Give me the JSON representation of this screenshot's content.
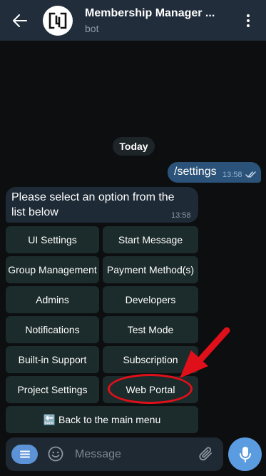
{
  "header": {
    "title": "Membership Manager ...",
    "subtitle": "bot",
    "back_icon": "arrow-left-icon",
    "menu_icon": "more-vertical-icon"
  },
  "date_badge": "Today",
  "outgoing_message": {
    "text": "/settings",
    "time": "13:58",
    "status_icon": "double-check-icon"
  },
  "incoming_message": {
    "text": "Please select an option from the list below",
    "time": "13:58"
  },
  "keyboard": {
    "ui_settings": "UI Settings",
    "start_message": "Start Message",
    "group_management": "Group Management",
    "payment_methods": "Payment Method(s)",
    "admins": "Admins",
    "developers": "Developers",
    "notifications": "Notifications",
    "test_mode": "Test Mode",
    "builtin_support": "Built-in Support",
    "subscription": "Subscription",
    "project_settings": "Project Settings",
    "web_portal": "Web Portal",
    "back_main_menu": "🔙 Back to the main menu"
  },
  "composer": {
    "placeholder": "Message",
    "menu_icon": "bot-menu-icon",
    "emoji_icon": "emoji-icon",
    "attach_icon": "paperclip-icon",
    "mic_icon": "microphone-icon"
  },
  "colors": {
    "header_bg": "#212d3b",
    "chat_bg": "#0d0e10",
    "outgoing_bubble": "#2b5278",
    "incoming_bubble": "#1e2a36",
    "keyboard_button": "#1c2b2b",
    "accent": "#5b9bdf",
    "annotation_red": "#e0101a"
  }
}
